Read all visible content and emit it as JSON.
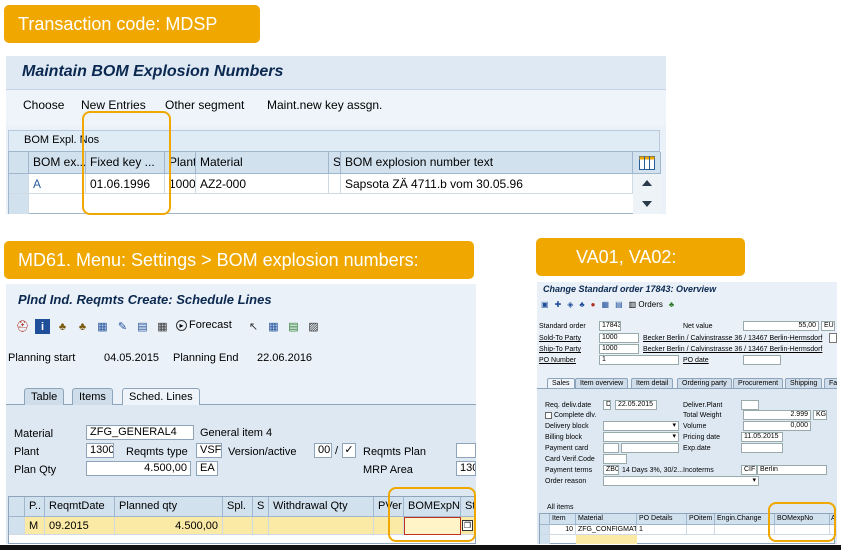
{
  "callouts": {
    "mdsp": "Transaction code: MDSP",
    "md61": "MD61. Menu: Settings > BOM explosion numbers:",
    "va01": "VA01, VA02:"
  },
  "mdsp": {
    "title": "Maintain BOM Explosion Numbers",
    "toolbar": [
      "Choose",
      "New Entries",
      "Other segment",
      "Maint.new key assgn."
    ],
    "table_title": "BOM Expl. Nos",
    "columns": [
      "BOM ex...",
      "Fixed key ...",
      "Plant",
      "Material",
      "S",
      "BOM explosion number text"
    ],
    "rows": [
      [
        "A",
        "01.06.1996",
        "1000",
        "AZ2-000",
        "",
        "Sapsota ZÄ 4711.b vom 30.05.96"
      ]
    ]
  },
  "md61": {
    "title": "Plnd Ind. Reqmts Create: Schedule Lines",
    "toolbar_forecast": "Forecast",
    "planning_start_label": "Planning start",
    "planning_start": "04.05.2015",
    "planning_end_label": "Planning End",
    "planning_end": "22.06.2016",
    "tabs": [
      "Table",
      "Items",
      "Sched. Lines"
    ],
    "material_label": "Material",
    "material": "ZFG_GENERAL4",
    "material_desc": "General item 4",
    "plant_label": "Plant",
    "plant": "1300",
    "reqmts_type_label": "Reqmts type",
    "reqmts_type": "VSF",
    "version_label": "Version/active",
    "version": "00",
    "version_check": "✓",
    "reqmts_plan_label": "Reqmts Plan",
    "plan_qty_label": "Plan Qty",
    "plan_qty": "4.500,00",
    "plan_unit": "EA",
    "mrp_area_label": "MRP Area",
    "mrp_area": "130",
    "columns": [
      "P..",
      "ReqmtDate",
      "Planned qty",
      "Spl.",
      "S",
      "Withdrawal Qty",
      "PVer",
      "BOMExpNo",
      "Sta"
    ],
    "row": [
      "M",
      "09.2015",
      "4.500,00",
      "",
      "",
      "",
      "",
      "",
      ""
    ]
  },
  "va": {
    "title": "Change Standard order 17843: Overview",
    "orders_btn": "Orders",
    "std_order_label": "Standard order",
    "std_order": "17843",
    "net_value_label": "Net value",
    "net_value": "55,00",
    "currency": "EUR",
    "sold_to_label": "Sold-To Party",
    "sold_to": "1000",
    "sold_to_name": "Becker Berlin / Calvinstrasse 36 / 13467 Berlin-Hermsdorf",
    "ship_to_label": "Ship-To Party",
    "ship_to": "1000",
    "ship_to_name": "Becker Berlin / Calvinstrasse 36 / 13467 Berlin-Hermsdorf",
    "po_number_label": "PO Number",
    "po_number": "1",
    "po_date_label": "PO date",
    "tabs": [
      "Sales",
      "Item overview",
      "Item detail",
      "Ordering party",
      "Procurement",
      "Shipping",
      "Fa"
    ],
    "req_deliv_label": "Req. deliv.date",
    "req_deliv_d": "D",
    "req_deliv": "22.05.2015",
    "deliver_plant_label": "Deliver.Plant",
    "complete_dlv_label": "Complete dlv.",
    "total_weight_label": "Total Weight",
    "total_weight": "2.999",
    "weight_unit": "KG",
    "delivery_block_label": "Delivery block",
    "volume_label": "Volume",
    "volume": "0,000",
    "billing_block_label": "Billing block",
    "pricing_date_label": "Pricing date",
    "pricing_date": "11.05.2015",
    "payment_card_label": "Payment card",
    "exp_date_label": "Exp.date",
    "card_verif_label": "Card Verif.Code",
    "payment_terms_label": "Payment terms",
    "payment_terms": "ZB01",
    "payment_terms_text": "14 Days 3%, 30/2...",
    "incoterms_label": "Incoterms",
    "incoterms": "CIF",
    "incoterms_place": "Berlin",
    "order_reason_label": "Order reason",
    "all_items": "All items",
    "columns": [
      "Item",
      "Material",
      "PO Details",
      "POitem",
      "Engin.Change",
      "BOMexpNo",
      "A"
    ],
    "row": [
      "10",
      "ZFG_CONFIGMAT3",
      "1",
      "",
      "",
      "",
      ""
    ]
  },
  "colors": {
    "callout": "#f0a800",
    "sap_bg": "#dfebf5",
    "title": "#0a2850"
  }
}
